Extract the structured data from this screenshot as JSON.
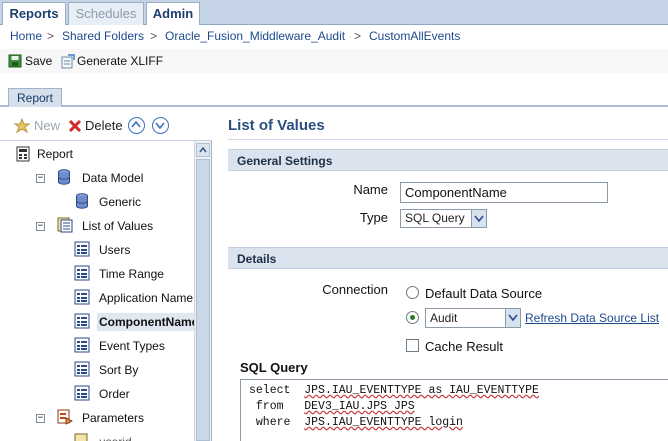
{
  "top_tabs": [
    {
      "label": "Reports",
      "active": true
    },
    {
      "label": "Schedules",
      "active": false
    },
    {
      "label": "Admin",
      "active": true
    }
  ],
  "breadcrumb": [
    "Home",
    "Shared Folders",
    "Oracle_Fusion_Middleware_Audit",
    "CustomAllEvents"
  ],
  "breadcrumb_sep": ">",
  "toolbar": {
    "save": "Save",
    "generate_xliff": "Generate XLIFF"
  },
  "report_tab": "Report",
  "left_toolbar": {
    "new": "New",
    "delete": "Delete"
  },
  "tree": {
    "report": "Report",
    "data_model": "Data Model",
    "generic": "Generic",
    "list_of_values": "List of Values",
    "lov_items": [
      "Users",
      "Time Range",
      "Application Name",
      "ComponentName",
      "Event Types",
      "Sort By",
      "Order"
    ],
    "parameters": "Parameters",
    "partial": "userid"
  },
  "panel": {
    "title": "List of Values",
    "general_settings": "General Settings",
    "name_label": "Name",
    "name_value": "ComponentName",
    "type_label": "Type",
    "type_value": "SQL Query",
    "details": "Details",
    "connection_label": "Connection",
    "default_ds": "Default Data Source",
    "conn_value": "Audit",
    "refresh_link": "Refresh Data Source List",
    "cache_result": "Cache Result",
    "sql_query_label": "SQL Query",
    "sql_lines": [
      {
        "kw": "select",
        "rest": "JPS.IAU_EVENTTYPE as IAU_EVENTTYPE"
      },
      {
        "kw": " from",
        "rest": "DEV3_IAU.JPS JPS"
      },
      {
        "kw": " where",
        "rest": "JPS.IAU_EVENTTYPE login"
      }
    ]
  },
  "colors": {
    "accent": "#1d4a8c",
    "section_bg": "#dbe4ee",
    "tab_bg": "#c4d4e6"
  }
}
